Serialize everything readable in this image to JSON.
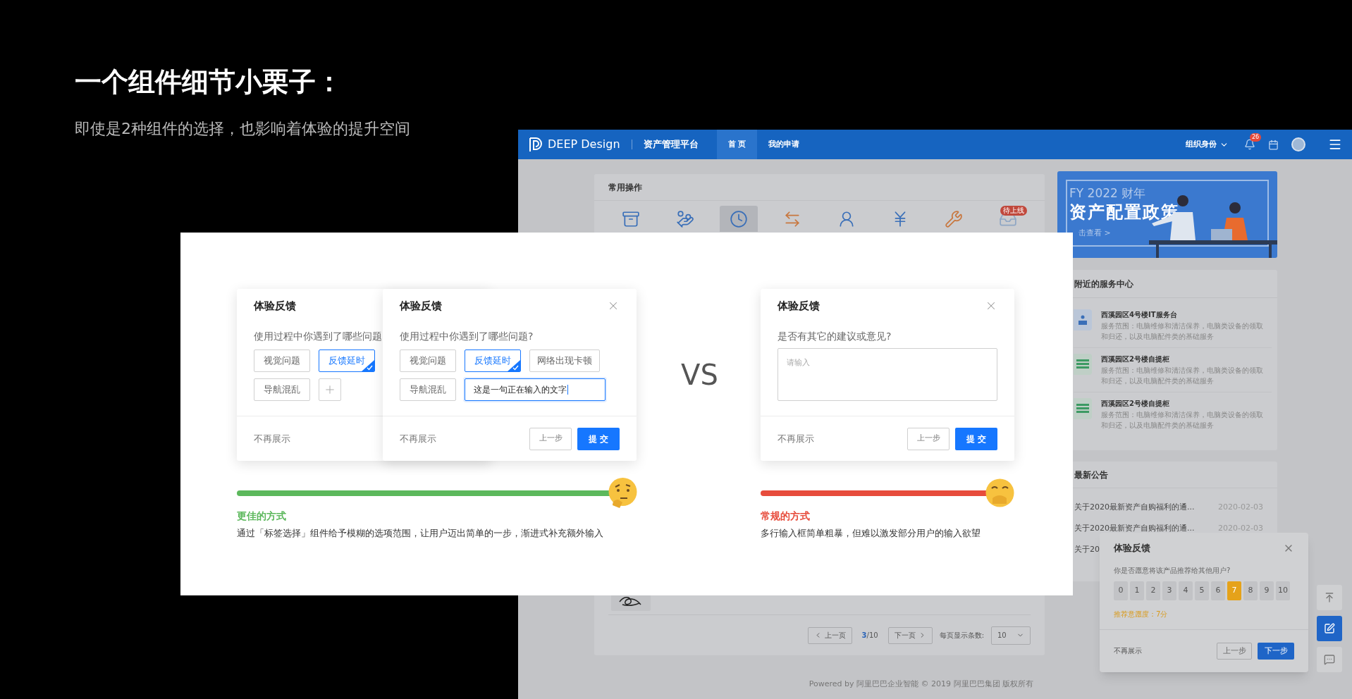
{
  "slide": {
    "title": "一个组件细节小栗子：",
    "subtitle": "即使是2种组件的选择，也影响着体验的提升空间"
  },
  "app": {
    "header": {
      "brand": "DEEP Design",
      "platform": "资产管理平台",
      "tabs": [
        {
          "label": "首 页",
          "selected": true
        },
        {
          "label": "我的申请",
          "selected": false
        }
      ],
      "org_menu": "组织身份",
      "notification_count": "26"
    },
    "quick_actions": {
      "title": "常用操作",
      "items": [
        {
          "kind": "box",
          "selected": false
        },
        {
          "kind": "hand",
          "selected": false
        },
        {
          "kind": "clock",
          "selected": true
        },
        {
          "kind": "swap",
          "selected": false
        },
        {
          "kind": "user",
          "selected": false
        },
        {
          "kind": "yen",
          "selected": false
        },
        {
          "kind": "tools",
          "selected": false
        },
        {
          "kind": "inbox",
          "selected": false,
          "badge": "待上线"
        }
      ]
    },
    "pagination": {
      "prev": "上一页",
      "current": "3",
      "total": "/10",
      "next": "下一页",
      "page_size_label": "每页显示条数:",
      "page_size": "10"
    },
    "footer": "Powered by 阿里巴巴企业智能 © 2019 阿里巴巴集团 版权所有",
    "banner": {
      "year": "FY 2022 财年",
      "title": "资产配置政策",
      "link": "击查看 >"
    },
    "service_center": {
      "title": "附近的服务中心",
      "items": [
        {
          "kind": "desk",
          "title": "西溪园区4号楼IT服务台",
          "description": "服务范围：电脑维修和清洁保养，电脑类设备的领取和归还，以及电脑配件类的基础服务"
        },
        {
          "kind": "locker",
          "title": "西溪园区2号楼自提柜",
          "description": "服务范围：电脑维修和清洁保养，电脑类设备的领取和归还，以及电脑配件类的基础服务"
        },
        {
          "kind": "locker",
          "title": "西溪园区2号楼自提柜",
          "description": "服务范围：电脑维修和清洁保养，电脑类设备的领取和归还，以及电脑配件类的基础服务"
        }
      ]
    },
    "announcements": {
      "title": "最新公告",
      "items": [
        {
          "title": "关于2020最新资产自购福利的通...",
          "date": "2020-02-03"
        },
        {
          "title": "关于2020最新资产自购福利的通...",
          "date": "2020-02-03"
        },
        {
          "title": "关于20"
        }
      ]
    },
    "feedback_popup": {
      "title": "体验反馈",
      "question": "你是否愿意将该产品推荐给其他用户?",
      "scores": [
        {
          "label": "0",
          "selected": false
        },
        {
          "label": "1",
          "selected": false
        },
        {
          "label": "2",
          "selected": false
        },
        {
          "label": "3",
          "selected": false
        },
        {
          "label": "4",
          "selected": false
        },
        {
          "label": "5",
          "selected": false
        },
        {
          "label": "6",
          "selected": false
        },
        {
          "label": "7",
          "selected": true
        },
        {
          "label": "8",
          "selected": false
        },
        {
          "label": "9",
          "selected": false
        },
        {
          "label": "10",
          "selected": false
        }
      ],
      "rating": "推荐意愿度：7分",
      "dismiss": "不再展示",
      "back": "上一步",
      "next": "下一步"
    }
  },
  "comparison": {
    "vs": "VS",
    "options": [
      {
        "kind": "tags",
        "color": "#5cb85c",
        "cards": [
          {
            "title": "体验反馈",
            "question": "使用过程中你遇到了哪些问题",
            "tags": [
              {
                "kind": "tag",
                "label": "视觉问题",
                "selected": false
              },
              {
                "kind": "tag",
                "label": "反馈延时",
                "selected": true
              },
              {
                "kind": "tag",
                "label": "导航混乱",
                "selected": false
              },
              {
                "kind": "add"
              }
            ],
            "dismiss": "不再展示"
          },
          {
            "title": "体验反馈",
            "question": "使用过程中你遇到了哪些问题?",
            "tags": [
              {
                "kind": "tag",
                "label": "视觉问题",
                "selected": false
              },
              {
                "kind": "tag",
                "label": "反馈延时",
                "selected": true
              },
              {
                "kind": "tag",
                "label": "网络出现卡顿",
                "selected": false
              },
              {
                "kind": "tag",
                "label": "导航混乱",
                "selected": false
              },
              {
                "kind": "input",
                "value": "这是一句正在输入的文字"
              }
            ],
            "dismiss": "不再展示",
            "back": "上一步",
            "submit": "提 交"
          }
        ],
        "verdict": "更佳的方式",
        "description": "通过「标签选择」组件给予模糊的选项范围，让用户迈出简单的一步，渐进式补充额外输入"
      },
      {
        "kind": "textarea",
        "color": "#e74c3c",
        "cards": [
          {
            "title": "体验反馈",
            "question": "是否有其它的建议或意见?",
            "placeholder": "请输入",
            "dismiss": "不再展示",
            "back": "上一步",
            "submit": "提 交"
          }
        ],
        "verdict": "常规的方式",
        "description": "多行输入框简单粗暴，但难以激发部分用户的输入欲望"
      }
    ]
  }
}
